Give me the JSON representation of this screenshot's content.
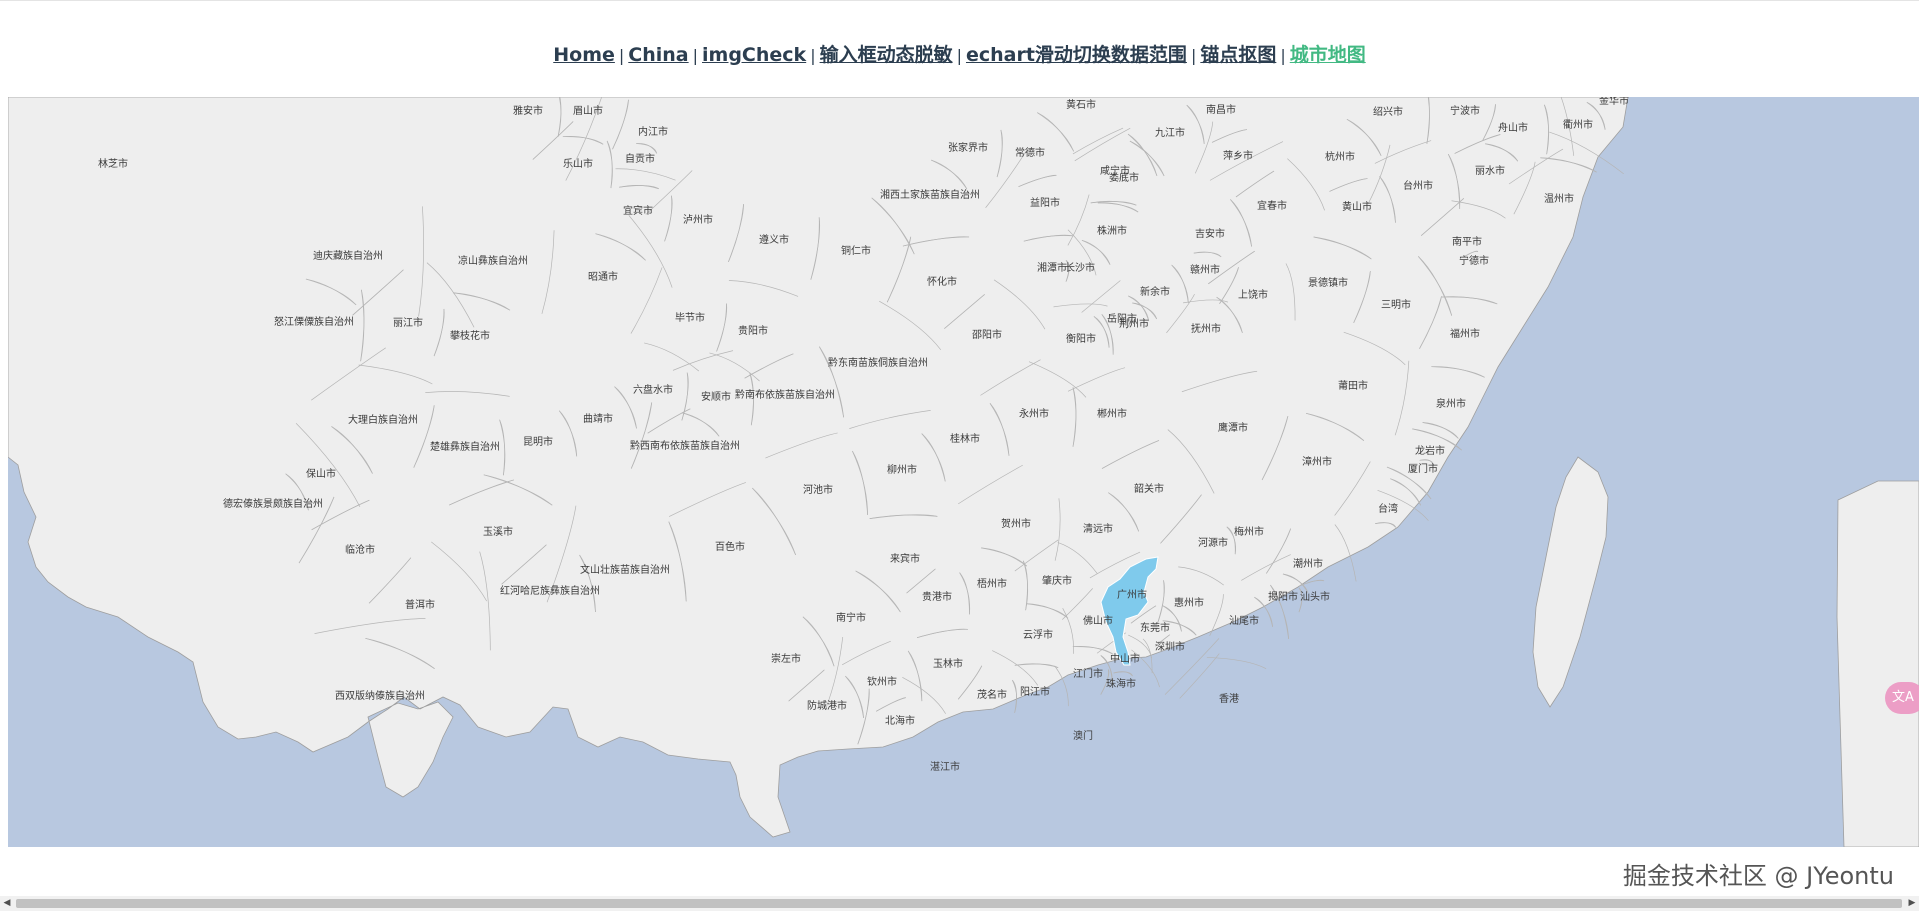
{
  "nav": {
    "links": [
      "Home",
      "China",
      "imgCheck",
      "输入框动态脱敏",
      "echart滑动切换数据范围",
      "锚点抠图",
      "城市地图"
    ],
    "separator": "|",
    "active_index": 6,
    "active_color": "#42b983",
    "link_color": "#2c3e50"
  },
  "map": {
    "highlighted_city": "广州市",
    "land_color": "#eeeeee",
    "sea_color": "#b8c8e0",
    "highlight_color": "#7fcaec",
    "border_color": "#b5b5b5",
    "labels": [
      "林芝市",
      "雅安市",
      "眉山市",
      "内江市",
      "自贡市",
      "乐山市",
      "宜宾市",
      "泸州市",
      "遵义市",
      "铜仁市",
      "凉山彝族自治州",
      "迪庆藏族自治州",
      "昭通市",
      "怒江傈僳族自治州",
      "丽江市",
      "攀枝花市",
      "毕节市",
      "贵阳市",
      "黔东南苗族侗族自治州",
      "六盘水市",
      "安顺市",
      "黔南布依族苗族自治州",
      "大理白族自治州",
      "楚雄彝族自治州",
      "昆明市",
      "曲靖市",
      "黔西南布依族苗族自治州",
      "保山市",
      "德宏傣族景颇族自治州",
      "玉溪市",
      "临沧市",
      "红河哈尼族彝族自治州",
      "文山壮族苗族自治州",
      "普洱市",
      "西双版纳傣族自治州",
      "百色市",
      "河池市",
      "柳州市",
      "桂林市",
      "来宾市",
      "贵港市",
      "梧州市",
      "南宁市",
      "崇左市",
      "防城港市",
      "钦州市",
      "北海市",
      "玉林市",
      "湛江市",
      "茂名市",
      "阳江市",
      "云浮市",
      "肇庆市",
      "佛山市",
      "广州市",
      "东莞市",
      "深圳市",
      "中山市",
      "江门市",
      "珠海市",
      "澳门",
      "香港",
      "惠州市",
      "河源市",
      "梅州市",
      "汕尾市",
      "揭阳市",
      "汕头市",
      "潮州市",
      "清远市",
      "韶关市",
      "贺州市",
      "永州市",
      "郴州市",
      "衡阳市",
      "邵阳市",
      "怀化市",
      "湘西土家族苗族自治州",
      "张家界市",
      "常德市",
      "益阳市",
      "娄底市",
      "湘潭市",
      "长沙市",
      "株洲市",
      "岳阳市",
      "荆州市",
      "咸宁市",
      "黄石市",
      "九江市",
      "南昌市",
      "萍乡市",
      "宜春市",
      "新余市",
      "吉安市",
      "赣州市",
      "抚州市",
      "鹰潭市",
      "上饶市",
      "景德镇市",
      "黄山市",
      "杭州市",
      "绍兴市",
      "宁波市",
      "舟山市",
      "衢州市",
      "金华市",
      "台州市",
      "丽水市",
      "温州市",
      "南平市",
      "宁德市",
      "三明市",
      "福州市",
      "莆田市",
      "泉州市",
      "龙岩市",
      "厦门市",
      "漳州市",
      "台湾"
    ]
  },
  "watermark": "掘金技术社区 @ JYeontu",
  "translate_icon": "translate-icon",
  "translate_glyph": "文A"
}
